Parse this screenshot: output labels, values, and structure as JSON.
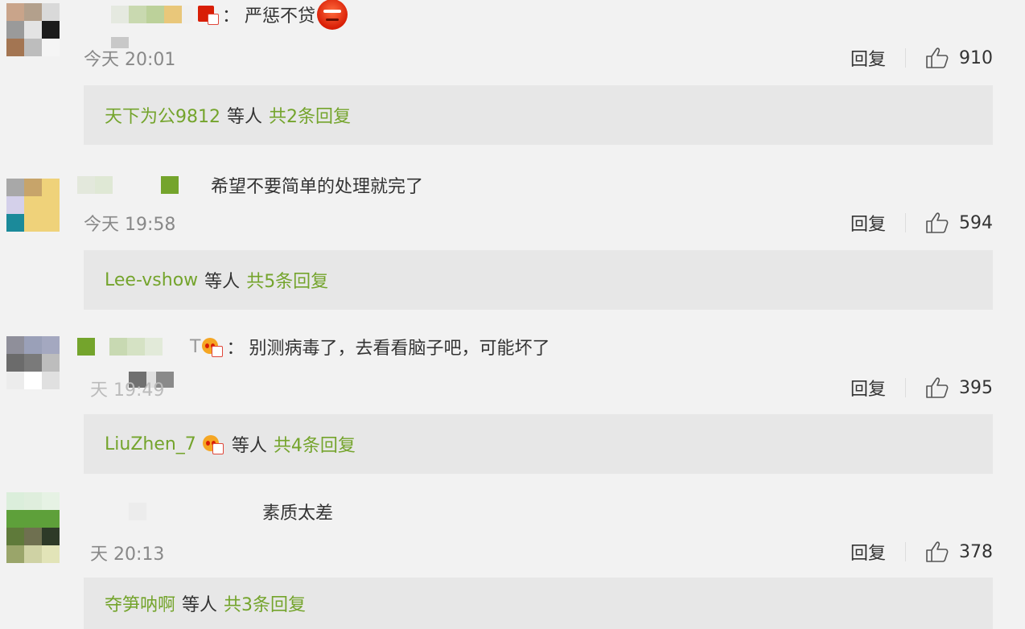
{
  "comments": [
    {
      "content": "严惩不贷",
      "time": "今天 20:01",
      "reply_label": "回复",
      "likes": "910",
      "replies": {
        "user": "天下为公9812",
        "middle": "等人",
        "count": "共2条回复"
      }
    },
    {
      "content": "希望不要简单的处理就完了",
      "time": "今天 19:58",
      "reply_label": "回复",
      "likes": "594",
      "replies": {
        "user": "Lee-vshow",
        "middle": "等人",
        "count": "共5条回复"
      }
    },
    {
      "user_suffix": "T",
      "content": "别测病毒了，去看看脑子吧，可能坏了",
      "time": "天 19:49",
      "reply_label": "回复",
      "likes": "395",
      "replies": {
        "user": "LiuZhen_7",
        "middle": "等人",
        "count": "共4条回复"
      }
    },
    {
      "content": "素质太差",
      "time": "天 20:13",
      "reply_label": "回复",
      "likes": "378",
      "replies": {
        "user": "夺笋呐啊",
        "middle": "等人",
        "count": "共3条回复"
      }
    }
  ],
  "colon": "：",
  "colors": {
    "link_green": "#74a42c",
    "reply_box": "#e7e7e7",
    "background": "#f2f2f2"
  },
  "icons": {
    "like": "thumbs-up-icon",
    "vip": "vip-badge-icon",
    "angry": "angry-emoji-icon"
  }
}
